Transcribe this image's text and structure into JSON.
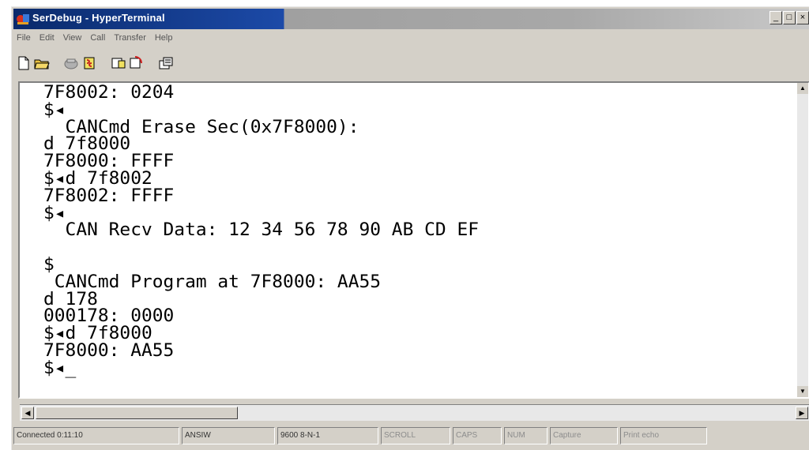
{
  "window": {
    "title": "SerDebug - HyperTerminal",
    "controls": [
      "_",
      "□",
      "×"
    ]
  },
  "menu": [
    "File",
    "Edit",
    "View",
    "Call",
    "Transfer",
    "Help"
  ],
  "toolbar": {
    "icons": [
      "new-icon",
      "open-icon",
      "call-icon",
      "disconnect-icon",
      "send-icon",
      "receive-icon",
      "properties-icon"
    ]
  },
  "terminal": {
    "lines": [
      "7F8002: 0204",
      "$◂",
      "  CANCmd Erase Sec(0x7F8000):",
      "d 7f8000",
      "7F8000: FFFF",
      "$◂d 7f8002",
      "7F8002: FFFF",
      "$◂",
      "  CAN Recv Data: 12 34 56 78 90 AB CD EF",
      "",
      "$",
      " CANCmd Program at 7F8000: AA55",
      "d 178",
      "000178: 0000",
      "$◂d 7f8000",
      "7F8000: AA55",
      "$◂_"
    ]
  },
  "status": {
    "connected": "Connected 0:11:10",
    "emulation": "ANSIW",
    "port_settings": "9600 8-N-1",
    "scroll": "SCROLL",
    "caps": "CAPS",
    "num": "NUM",
    "capture": "Capture",
    "print_echo": "Print echo"
  }
}
